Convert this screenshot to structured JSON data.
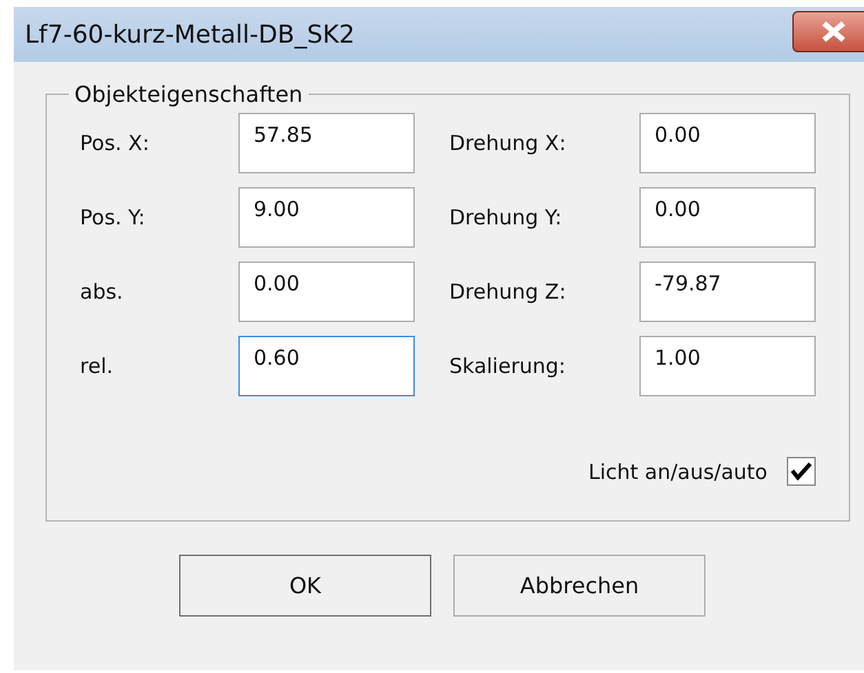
{
  "window": {
    "title": "Lf7-60-kurz-Metall-DB_SK2"
  },
  "group": {
    "title": "Objekteigenschaften"
  },
  "fields": [
    {
      "label": "Pos. X:",
      "value": "57.85",
      "focused": false
    },
    {
      "label": "Drehung X:",
      "value": "0.00",
      "focused": false
    },
    {
      "label": "Pos. Y:",
      "value": "9.00",
      "focused": false
    },
    {
      "label": "Drehung Y:",
      "value": "0.00",
      "focused": false
    },
    {
      "label": "abs.",
      "value": "0.00",
      "focused": false
    },
    {
      "label": "Drehung Z:",
      "value": "-79.87",
      "focused": false
    },
    {
      "label": "rel.",
      "value": "0.60",
      "focused": true
    },
    {
      "label": "Skalierung:",
      "value": "1.00",
      "focused": false
    }
  ],
  "checkbox": {
    "label": "Licht an/aus/auto",
    "checked": true
  },
  "buttons": [
    {
      "label": "OK",
      "default": true
    },
    {
      "label": "Abbrechen",
      "default": false
    }
  ]
}
